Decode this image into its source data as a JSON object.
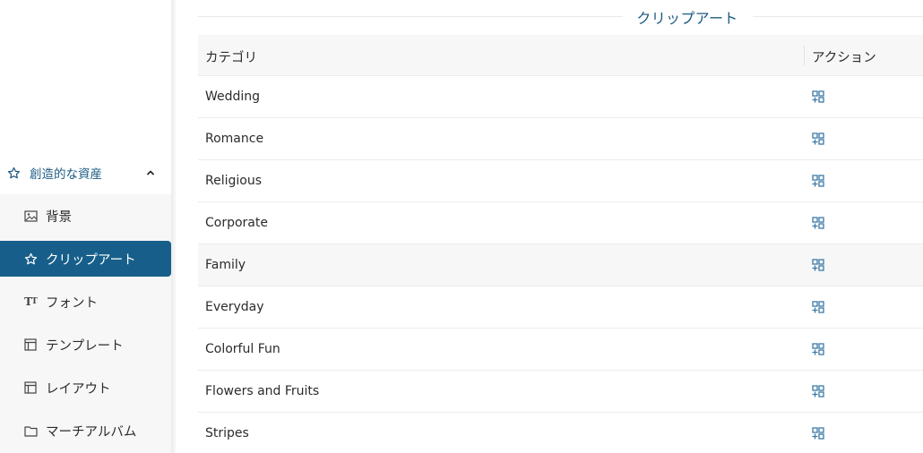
{
  "sidebar": {
    "section": {
      "label": "創造的な資産",
      "icon": "star-icon",
      "expanded": true
    },
    "items": [
      {
        "label": "背景",
        "icon": "image-icon",
        "active": false
      },
      {
        "label": "クリップアート",
        "icon": "star-icon",
        "active": true
      },
      {
        "label": "フォント",
        "icon": "text-size-icon",
        "active": false
      },
      {
        "label": "テンプレート",
        "icon": "template-icon",
        "active": false
      },
      {
        "label": "レイアウト",
        "icon": "layout-icon",
        "active": false
      },
      {
        "label": "マーチアルバム",
        "icon": "folder-icon",
        "active": false
      }
    ]
  },
  "main": {
    "title": "クリップアート",
    "table": {
      "headers": {
        "category": "カテゴリ",
        "action": "アクション"
      },
      "action_icon": "edit-grid-icon",
      "rows": [
        {
          "category": "Wedding"
        },
        {
          "category": "Romance"
        },
        {
          "category": "Religious"
        },
        {
          "category": "Corporate"
        },
        {
          "category": "Family"
        },
        {
          "category": "Everyday"
        },
        {
          "category": "Colorful Fun"
        },
        {
          "category": "Flowers and Fruits"
        },
        {
          "category": "Stripes"
        }
      ]
    }
  },
  "colors": {
    "accent": "#175f8a",
    "accent_text": "#1b5a82",
    "action_icon": "#3b7aa8",
    "sidebar_bg": "#f7f7f7",
    "header_bg": "#f7f7f7"
  }
}
